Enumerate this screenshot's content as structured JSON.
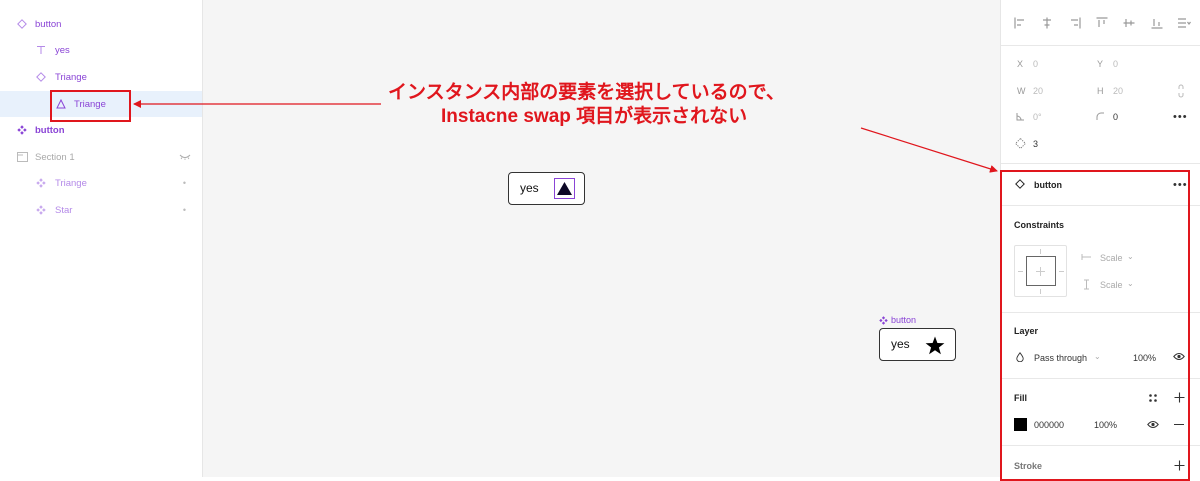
{
  "layers": {
    "items": [
      {
        "label": "button",
        "icon": "component-outline-icon"
      },
      {
        "label": "yes",
        "icon": "text-icon"
      },
      {
        "label": "Triange",
        "icon": "component-outline-icon"
      },
      {
        "label": "Triange",
        "icon": "triangle-icon"
      },
      {
        "label": "button",
        "icon": "component-set-icon"
      },
      {
        "label": "Section 1",
        "icon": "section-icon"
      },
      {
        "label": "Triange",
        "icon": "component-set-icon"
      },
      {
        "label": "Star",
        "icon": "component-set-icon"
      }
    ]
  },
  "canvas": {
    "instance_1_text": "yes",
    "instance_2_label": "button",
    "instance_2_text": "yes"
  },
  "annotation": {
    "line1": "インスタンス内部の要素を選択しているので、",
    "line2": "Instacne swap 項目が表示されない"
  },
  "properties": {
    "x_label": "X",
    "x_value": "0",
    "y_label": "Y",
    "y_value": "0",
    "w_label": "W",
    "w_value": "20",
    "h_label": "H",
    "h_value": "20",
    "rotation_value": "0°",
    "radius_value": "0",
    "count_value": "3",
    "component_name": "button",
    "constraints_title": "Constraints",
    "constraint_h": "Scale",
    "constraint_v": "Scale",
    "layer_title": "Layer",
    "blend_mode": "Pass through",
    "layer_opacity": "100%",
    "fill_title": "Fill",
    "fill_hex": "000000",
    "fill_opacity": "100%",
    "stroke_title": "Stroke"
  },
  "colors": {
    "accent_purple": "#8a44d6",
    "annotation_red": "#e0161d",
    "selection_blue": "#e8f1fc",
    "fill_swatch": "#000000"
  }
}
